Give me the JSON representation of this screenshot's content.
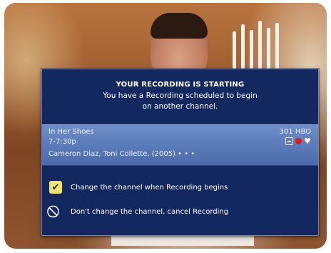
{
  "dialog": {
    "title": "YOUR RECORDING IS STARTING",
    "message_line1": "You have a Recording scheduled to begin",
    "message_line2": "on another channel.",
    "program": {
      "title": "In Her Shoes",
      "time": "7-7:30p",
      "cast": "Cameron Diaz, Toni Collette, (2005) • • •",
      "channel": "301 HBO",
      "status_icons": [
        "info-box-icon",
        "record-dot-icon",
        "favorite-heart-icon"
      ]
    },
    "options": [
      {
        "label": "Change the channel when Recording begins",
        "icon": "checkmark-icon",
        "selected": true
      },
      {
        "label": "Don't change the channel, cancel Recording",
        "icon": "cancel-icon",
        "selected": false
      }
    ]
  },
  "colors": {
    "dialog_bg": "#13285f",
    "info_band": "#5b7bb9",
    "selected_highlight": "#f2e36a",
    "record_dot": "#e01b1b"
  }
}
